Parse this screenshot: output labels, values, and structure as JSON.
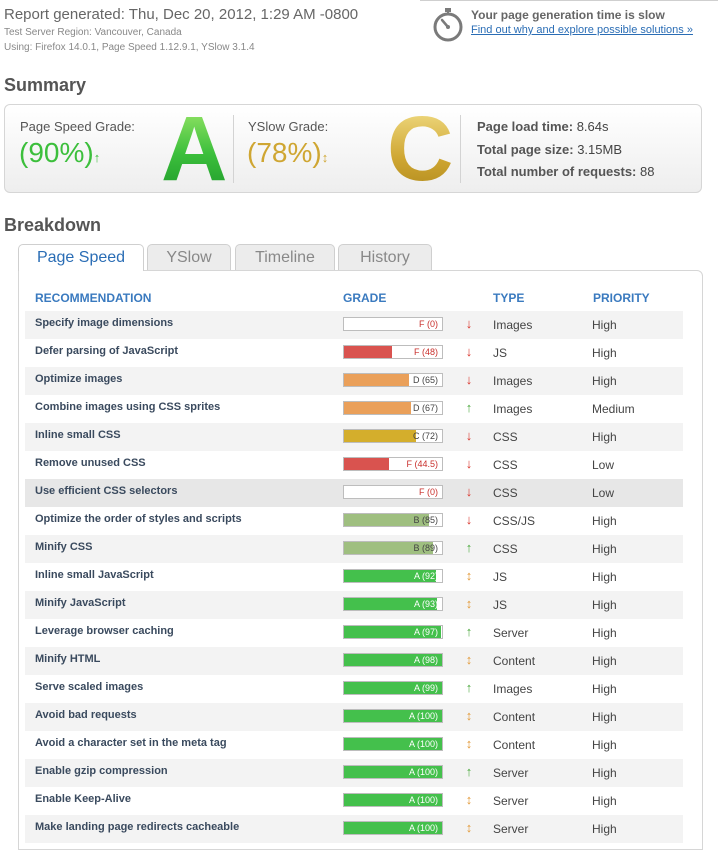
{
  "report": {
    "title": "Report generated: Thu, Dec 20, 2012, 1:29 AM -0800",
    "region": "Test Server Region: Vancouver, Canada",
    "using": "Using: Firefox 14.0.1, Page Speed 1.12.9.1, YSlow 3.1.4"
  },
  "slow_notice": {
    "title": "Your page generation time is slow",
    "link": "Find out why and explore possible solutions »",
    "icon": "stopwatch-icon"
  },
  "summary": {
    "heading": "Summary",
    "pagespeed": {
      "label": "Page Speed Grade:",
      "value": "(90%)",
      "arrow": "↑",
      "letter": "A",
      "color": "#3cbf3c"
    },
    "yslow": {
      "label": "YSlow Grade:",
      "value": "(78%)",
      "arrow": "↕",
      "letter": "C",
      "color": "#cfa632"
    },
    "stats": [
      {
        "label": "Page load time:",
        "value": "8.64s"
      },
      {
        "label": "Total page size:",
        "value": "3.15MB"
      },
      {
        "label": "Total number of requests:",
        "value": "88"
      }
    ]
  },
  "breakdown": {
    "heading": "Breakdown",
    "tabs": [
      "Page Speed",
      "YSlow",
      "Timeline",
      "History"
    ],
    "active_tab": "Page Speed",
    "columns": [
      "RECOMMENDATION",
      "GRADE",
      "TYPE",
      "PRIORITY"
    ],
    "colors": {
      "F": "#d9534f",
      "D": "#eaa05a",
      "C": "#d4ae2c",
      "B": "#9fbf80",
      "A": "#44c04c",
      "trend_down": "#d9342b",
      "trend_up": "#4aa83c",
      "trend_neutral": "#e39a3a"
    },
    "rows": [
      {
        "name": "Specify image dimensions",
        "grade": "F (0)",
        "letter": "F",
        "score": 0,
        "trend": "down",
        "type": "Images",
        "priority": "High"
      },
      {
        "name": "Defer parsing of JavaScript",
        "grade": "F (48)",
        "letter": "F",
        "score": 48,
        "trend": "down",
        "type": "JS",
        "priority": "High"
      },
      {
        "name": "Optimize images",
        "grade": "D (65)",
        "letter": "D",
        "score": 65,
        "trend": "down",
        "type": "Images",
        "priority": "High"
      },
      {
        "name": "Combine images using CSS sprites",
        "grade": "D (67)",
        "letter": "D",
        "score": 67,
        "trend": "up",
        "type": "Images",
        "priority": "Medium"
      },
      {
        "name": "Inline small CSS",
        "grade": "C (72)",
        "letter": "C",
        "score": 72,
        "trend": "down",
        "type": "CSS",
        "priority": "High"
      },
      {
        "name": "Remove unused CSS",
        "grade": "F (44.5)",
        "letter": "F",
        "score": 44.5,
        "trend": "down",
        "type": "CSS",
        "priority": "Low"
      },
      {
        "name": "Use efficient CSS selectors",
        "grade": "F (0)",
        "letter": "F",
        "score": 0,
        "trend": "down",
        "type": "CSS",
        "priority": "Low"
      },
      {
        "name": "Optimize the order of styles and scripts",
        "grade": "B (85)",
        "letter": "B",
        "score": 85,
        "trend": "down",
        "type": "CSS/JS",
        "priority": "High"
      },
      {
        "name": "Minify CSS",
        "grade": "B (89)",
        "letter": "B",
        "score": 89,
        "trend": "up",
        "type": "CSS",
        "priority": "High"
      },
      {
        "name": "Inline small JavaScript",
        "grade": "A (92)",
        "letter": "A",
        "score": 92,
        "trend": "neutral",
        "type": "JS",
        "priority": "High"
      },
      {
        "name": "Minify JavaScript",
        "grade": "A (93)",
        "letter": "A",
        "score": 93,
        "trend": "neutral",
        "type": "JS",
        "priority": "High"
      },
      {
        "name": "Leverage browser caching",
        "grade": "A (97)",
        "letter": "A",
        "score": 97,
        "trend": "up",
        "type": "Server",
        "priority": "High"
      },
      {
        "name": "Minify HTML",
        "grade": "A (98)",
        "letter": "A",
        "score": 98,
        "trend": "neutral",
        "type": "Content",
        "priority": "High"
      },
      {
        "name": "Serve scaled images",
        "grade": "A (99)",
        "letter": "A",
        "score": 99,
        "trend": "up",
        "type": "Images",
        "priority": "High"
      },
      {
        "name": "Avoid bad requests",
        "grade": "A (100)",
        "letter": "A",
        "score": 100,
        "trend": "neutral",
        "type": "Content",
        "priority": "High"
      },
      {
        "name": "Avoid a character set in the meta tag",
        "grade": "A (100)",
        "letter": "A",
        "score": 100,
        "trend": "neutral",
        "type": "Content",
        "priority": "High"
      },
      {
        "name": "Enable gzip compression",
        "grade": "A (100)",
        "letter": "A",
        "score": 100,
        "trend": "up",
        "type": "Server",
        "priority": "High"
      },
      {
        "name": "Enable Keep-Alive",
        "grade": "A (100)",
        "letter": "A",
        "score": 100,
        "trend": "neutral",
        "type": "Server",
        "priority": "High"
      },
      {
        "name": "Make landing page redirects cacheable",
        "grade": "A (100)",
        "letter": "A",
        "score": 100,
        "trend": "neutral",
        "type": "Server",
        "priority": "High"
      }
    ]
  }
}
